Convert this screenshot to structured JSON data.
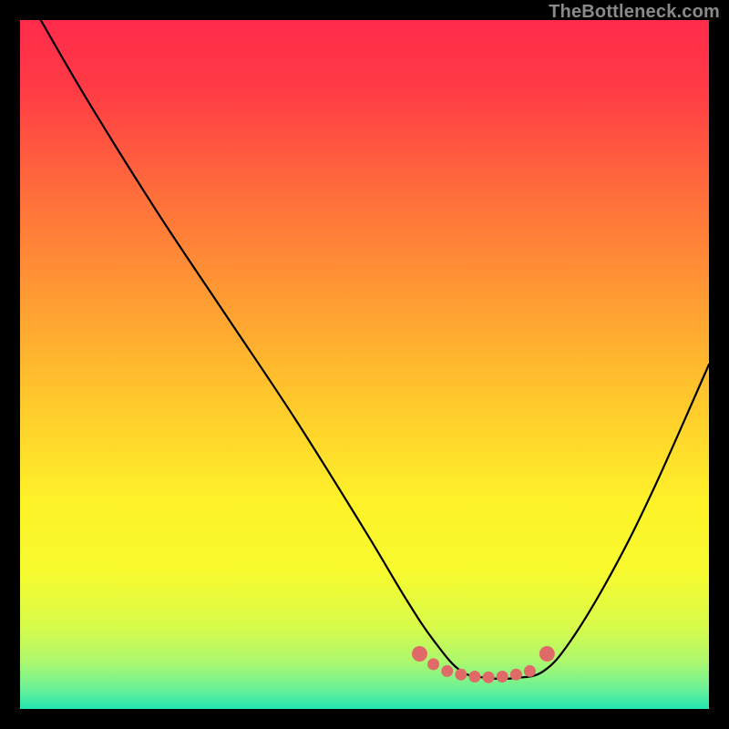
{
  "watermark": "TheBottleneck.com",
  "gradient_stops": [
    {
      "offset": 0.0,
      "color": "#ff2b4b"
    },
    {
      "offset": 0.1,
      "color": "#ff3b45"
    },
    {
      "offset": 0.25,
      "color": "#ff6d3b"
    },
    {
      "offset": 0.4,
      "color": "#ff9a33"
    },
    {
      "offset": 0.55,
      "color": "#ffc82c"
    },
    {
      "offset": 0.7,
      "color": "#fef229"
    },
    {
      "offset": 0.8,
      "color": "#f7fb2e"
    },
    {
      "offset": 0.88,
      "color": "#d8fb4a"
    },
    {
      "offset": 0.93,
      "color": "#aef86d"
    },
    {
      "offset": 0.97,
      "color": "#6cf195"
    },
    {
      "offset": 1.0,
      "color": "#22e6b0"
    }
  ],
  "curve_color": "#000000",
  "marker_color": "#e06a68",
  "chart_data": {
    "type": "line",
    "title": "",
    "xlabel": "",
    "ylabel": "",
    "xlim": [
      0,
      100
    ],
    "ylim": [
      0,
      100
    ],
    "annotations": [],
    "series": [
      {
        "name": "bottleneck-curve",
        "x": [
          3,
          10,
          20,
          30,
          40,
          50,
          56,
          60,
          64,
          68,
          72,
          76,
          80,
          86,
          92,
          100
        ],
        "values": [
          100,
          88,
          72,
          57,
          42,
          26,
          16,
          10,
          5.5,
          4.5,
          4.5,
          5.5,
          10,
          20,
          32,
          50
        ]
      }
    ],
    "markers": {
      "name": "highlight-band",
      "x": [
        58.0,
        60.0,
        62.0,
        64.0,
        66.0,
        68.0,
        70.0,
        72.0,
        74.0,
        76.5
      ],
      "values": [
        8.0,
        6.5,
        5.5,
        5.0,
        4.7,
        4.6,
        4.7,
        5.0,
        5.5,
        8.0
      ]
    }
  }
}
